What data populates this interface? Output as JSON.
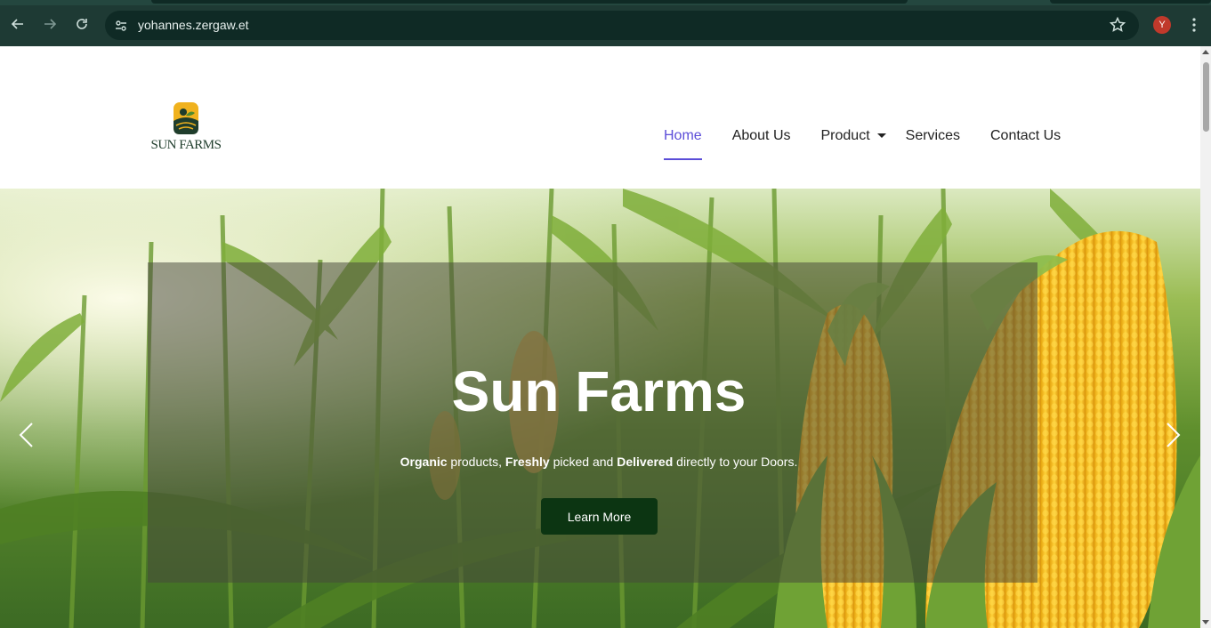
{
  "browser": {
    "url": "yohannes.zergaw.et",
    "profile_initial": "Y"
  },
  "site": {
    "logo_text": "SUN FARMS",
    "nav": [
      {
        "label": "Home",
        "active": true
      },
      {
        "label": "About Us"
      },
      {
        "label": "Product",
        "has_dropdown": true
      },
      {
        "label": "Services"
      },
      {
        "label": "Contact Us"
      }
    ],
    "accent_color": "#5b4dd8"
  },
  "hero": {
    "title": "Sun Farms",
    "tagline_parts": [
      "Organic",
      " products, ",
      "Freshly",
      " picked and ",
      "Delivered",
      " directly to your Doors."
    ],
    "button_label": "Learn More",
    "button_color": "#0c3512"
  },
  "icons": {
    "back": "arrow-left-icon",
    "forward": "arrow-right-icon",
    "reload": "reload-icon",
    "site_info": "tune-icon",
    "bookmark": "star-icon",
    "menu": "more-vert-icon",
    "carousel_prev": "chevron-left-icon",
    "carousel_next": "chevron-right-icon"
  }
}
